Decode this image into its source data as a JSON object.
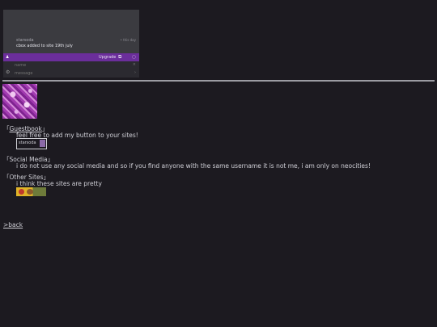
{
  "cbox": {
    "user": "starsoda",
    "time": "• this day",
    "message": "cbox added to site 19th july",
    "upgrade_label": "Upgrade",
    "name_placeholder": "name",
    "message_placeholder": "message",
    "send_glyph": "›",
    "close_glyph": "×",
    "user_glyph": "♟",
    "ext_glyph": "⧉",
    "more_glyph": "○",
    "gear_glyph": "⚙"
  },
  "sections": {
    "guestbook": {
      "open": "「",
      "link": "Guestbook",
      "close": "」",
      "text": "feel free to add my button to your sites!",
      "button_text": "starsoda"
    },
    "social": {
      "title": "「Social Media」",
      "text": "i do not use any social media and so if you find anyone with the same username it is not me, i am only on neocities!"
    },
    "other": {
      "title": "「Other Sites」",
      "text": "i think these sites are pretty"
    }
  },
  "back_link": ">back",
  "colors": {
    "accent": "#6b2e9b",
    "background": "#1c1a20"
  }
}
